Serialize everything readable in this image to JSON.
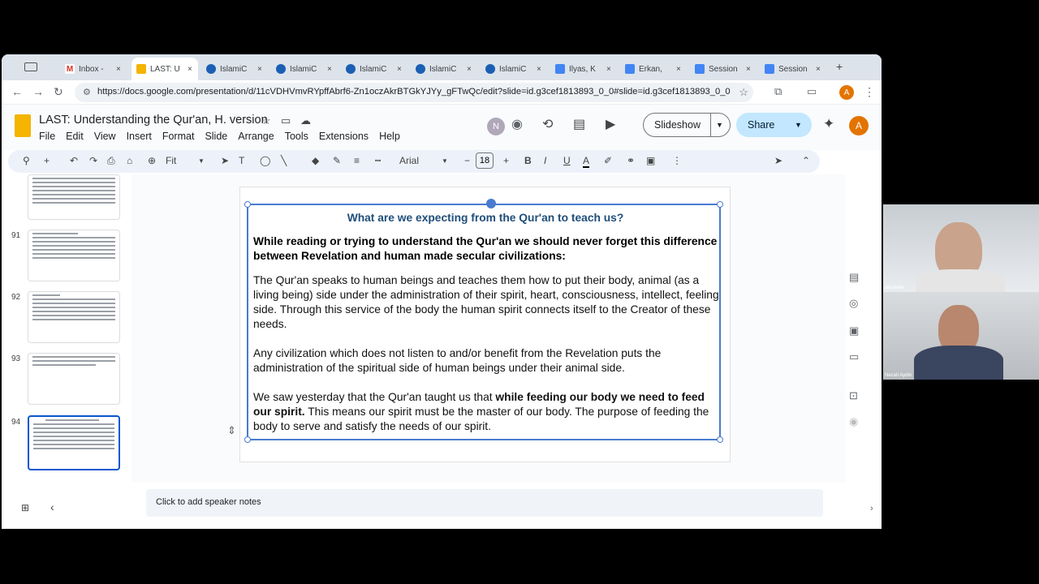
{
  "tabs": [
    {
      "label": "Inbox - ",
      "icon": "gmail-icon",
      "kind": "gmail"
    },
    {
      "label": "LAST: U",
      "icon": "slides-icon",
      "kind": "slides",
      "active": true
    },
    {
      "label": "IslamiC",
      "icon": "globe-icon",
      "kind": "globe"
    },
    {
      "label": "IslamiC",
      "icon": "globe-icon",
      "kind": "globe"
    },
    {
      "label": "IslamiC",
      "icon": "globe-icon",
      "kind": "globe"
    },
    {
      "label": "IslamiC",
      "icon": "globe-icon",
      "kind": "globe"
    },
    {
      "label": "IslamiC",
      "icon": "globe-icon",
      "kind": "globe"
    },
    {
      "label": "Ilyas, K",
      "icon": "docs-icon",
      "kind": "doc"
    },
    {
      "label": "Erkan, ",
      "icon": "docs-icon",
      "kind": "doc"
    },
    {
      "label": "Session",
      "icon": "docs-icon",
      "kind": "doc"
    },
    {
      "label": "Session",
      "icon": "docs-icon",
      "kind": "doc"
    }
  ],
  "address": {
    "url": "https://docs.google.com/presentation/d/11cVDHVmvRYpffAbrf6-Zn1oczAkrBTGkYJYy_gFTwQc/edit?slide=id.g3cef1813893_0_0#slide=id.g3cef1813893_0_0"
  },
  "profile": {
    "initial": "A",
    "collab_initial": "N"
  },
  "doc": {
    "title": "LAST: Understanding the Qur'an, H. version"
  },
  "menus": [
    "File",
    "Edit",
    "View",
    "Insert",
    "Format",
    "Slide",
    "Arrange",
    "Tools",
    "Extensions",
    "Help"
  ],
  "buttons": {
    "slideshow": "Slideshow",
    "share": "Share"
  },
  "toolbar": {
    "zoom": "Fit",
    "font": "Arial",
    "font_size": "18"
  },
  "filmstrip": {
    "numbers": [
      "91",
      "92",
      "93",
      "94"
    ]
  },
  "slide": {
    "title": "What are we expecting from the Qur'an to teach us?",
    "bold_intro": "While reading or trying to understand the Qur'an we should never forget this difference between Revelation and human made secular civilizations:",
    "para1": "The Qur'an speaks to human beings and teaches them how to put their body, animal (as a living being) side under the administration of their spirit, heart, consciousness, intellect, feeling side. Through this service of the body the human spirit connects itself to the Creator of these needs.",
    "para2": "Any civilization which does not listen to and/or benefit from the Revelation puts the administration of the spiritual side of human beings under their animal side.",
    "para3_a": "We saw yesterday that the Qur'an taught us that ",
    "para3_b": "while feeding our body we need to feed our spirit.",
    "para3_c": " This means our spirit must be the master of our body. The purpose of feeding the body to serve and satisfy the needs of our spirit."
  },
  "notes": {
    "placeholder": "Click to add speaker notes"
  },
  "video": {
    "name1": "alimanier",
    "name2": "Necati Aydin"
  }
}
